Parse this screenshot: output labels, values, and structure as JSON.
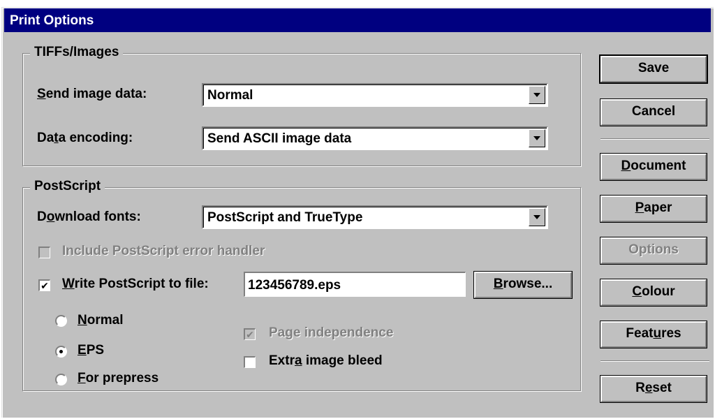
{
  "title": "Print Options",
  "tiffs_group": {
    "legend": "TIFFs/Images",
    "send_image_label": "Send image data:",
    "send_image_value": "Normal",
    "data_encoding_label": "Data encoding:",
    "data_encoding_value": "Send ASCII image data"
  },
  "postscript_group": {
    "legend": "PostScript",
    "download_fonts_label": "Download fonts:",
    "download_fonts_value": "PostScript and TrueType",
    "error_handler_label": "Include PostScript error handler",
    "error_handler_checked": false,
    "write_to_file_label": "Write PostScript to file:",
    "write_to_file_checked": true,
    "filename": "123456789.eps",
    "browse_label": "Browse...",
    "radios": [
      {
        "label": "Normal",
        "selected": false
      },
      {
        "label": "EPS",
        "selected": true
      },
      {
        "label": "For prepress",
        "selected": false
      }
    ],
    "page_independence_label": "Page independence",
    "page_independence_checked": true,
    "extra_bleed_label": "Extra image bleed",
    "extra_bleed_checked": false
  },
  "buttons": {
    "save": "Save",
    "cancel": "Cancel",
    "document": "Document",
    "paper": "Paper",
    "options": "Options",
    "colour": "Colour",
    "features": "Features",
    "reset": "Reset"
  },
  "colors": {
    "titlebar": "#000080",
    "face": "#c0c0c0"
  }
}
